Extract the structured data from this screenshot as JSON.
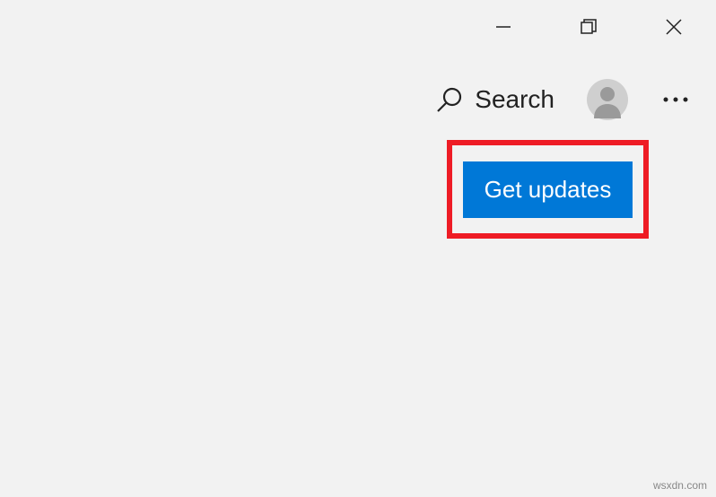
{
  "toolbar": {
    "search_label": "Search"
  },
  "main": {
    "get_updates_label": "Get updates"
  },
  "watermark": "wsxdn.com"
}
